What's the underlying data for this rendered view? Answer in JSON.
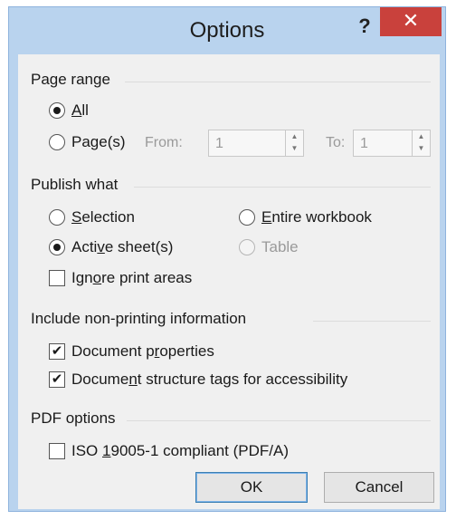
{
  "window": {
    "title": "Options",
    "help_glyph": "?",
    "close_glyph": "✕"
  },
  "page_range": {
    "header": "Page range",
    "all_pre": "",
    "all_u": "A",
    "all_post": "ll",
    "pages_pre": "Pa",
    "pages_u": "g",
    "pages_post": "e(s)",
    "from_label": "From:",
    "from_value": "1",
    "to_label": "To:",
    "to_value": "1"
  },
  "publish_what": {
    "header": "Publish what",
    "selection_u": "S",
    "selection_post": "election",
    "entire_u": "E",
    "entire_post": "ntire workbook",
    "active_pre": "Acti",
    "active_u": "v",
    "active_post": "e sheet(s)",
    "table": "Table",
    "ignore_pre": "Ign",
    "ignore_u": "o",
    "ignore_post": "re print areas"
  },
  "non_printing": {
    "header": "Include non-printing information",
    "doc_props_pre": "Document p",
    "doc_props_u": "r",
    "doc_props_post": "operties",
    "doc_struct_pre": "Docume",
    "doc_struct_u": "n",
    "doc_struct_post": "t structure tags for accessibility"
  },
  "pdf_options": {
    "header": "PDF options",
    "iso_pre": "ISO ",
    "iso_u": "1",
    "iso_post": "9005-1 compliant (PDF/A)"
  },
  "buttons": {
    "ok": "OK",
    "cancel": "Cancel"
  },
  "state": {
    "page_range_selected": "All",
    "publish_selected": "Active sheet(s)",
    "ignore_print_areas": false,
    "document_properties": true,
    "document_structure_tags": true,
    "iso_compliant": false,
    "table_enabled": false
  },
  "icons": {
    "checkmark": "✔",
    "spin_up": "▲",
    "spin_down": "▼"
  }
}
